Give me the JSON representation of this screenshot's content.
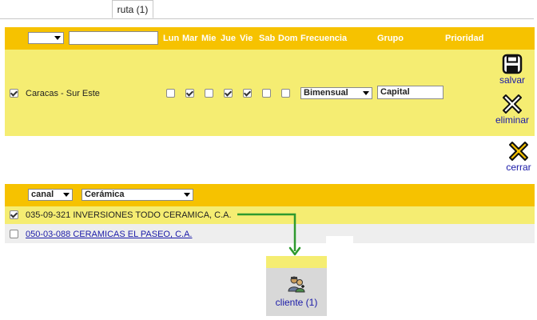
{
  "tab": {
    "label": "ruta (1)"
  },
  "route_header": {
    "filter_select": "",
    "filter_text": "",
    "days": [
      "Lun",
      "Mar",
      "Mie",
      "Jue",
      "Vie",
      "Sab",
      "Dom"
    ],
    "frecuencia": "Frecuencia",
    "grupo": "Grupo",
    "prioridad": "Prioridad"
  },
  "route_row": {
    "checked": true,
    "name": "Caracas - Sur Este",
    "days_checked": [
      false,
      true,
      false,
      true,
      true,
      false,
      false
    ],
    "frecuencia_value": "Bimensual",
    "grupo_value": "Capital"
  },
  "actions": {
    "salvar": "salvar",
    "eliminar": "eliminar",
    "cerrar": "cerrar"
  },
  "client_filter": {
    "type_select": "canal",
    "canal_select": "Cerámica"
  },
  "clients": [
    {
      "checked": true,
      "text": "035-09-321 INVERSIONES TODO CERAMICA, C.A.",
      "link": false
    },
    {
      "checked": false,
      "text": "050-03-088 CERAMICAS EL PASEO, C.A.",
      "link": true
    }
  ],
  "cliente_button": {
    "label": "cliente (1)"
  },
  "colors": {
    "header": "#f6c200",
    "row": "#f5ed72",
    "alt_row": "#eeeeee",
    "connector": "#2e9a2e",
    "link": "#1a1aa8"
  },
  "icons": {
    "save": "floppy-disk-icon",
    "delete": "x-cross-icon",
    "close": "x-cross-icon",
    "client": "people-group-icon"
  }
}
